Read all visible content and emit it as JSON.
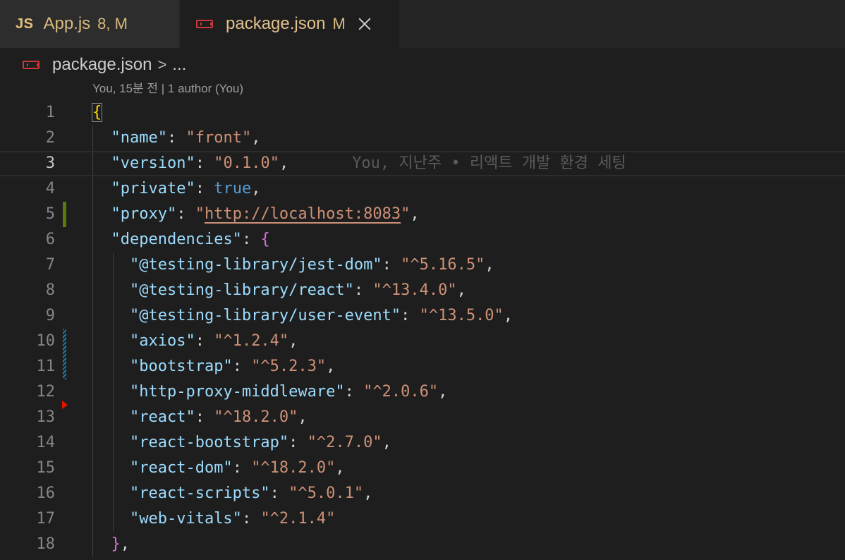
{
  "tabs": [
    {
      "badge": "JS",
      "label": "App.js",
      "status": "8, M"
    },
    {
      "label": "package.json",
      "status": "M"
    }
  ],
  "breadcrumb": {
    "file": "package.json",
    "separator": ">",
    "more": "..."
  },
  "codelens": "You, 15분 전 | 1 author (You)",
  "blame": "You, 지난주 • 리액트 개발 환경 세팅",
  "current_line": 3,
  "lines": [
    {
      "n": "1"
    },
    {
      "n": "2"
    },
    {
      "n": "3"
    },
    {
      "n": "4"
    },
    {
      "n": "5"
    },
    {
      "n": "6"
    },
    {
      "n": "7"
    },
    {
      "n": "8"
    },
    {
      "n": "9"
    },
    {
      "n": "10"
    },
    {
      "n": "11"
    },
    {
      "n": "12"
    },
    {
      "n": "13"
    },
    {
      "n": "14"
    },
    {
      "n": "15"
    },
    {
      "n": "16"
    },
    {
      "n": "17"
    },
    {
      "n": "18"
    }
  ],
  "code": {
    "name_key": "\"name\"",
    "name_val": "\"front\"",
    "version_key": "\"version\"",
    "version_val": "\"0.1.0\"",
    "private_key": "\"private\"",
    "private_val": "true",
    "proxy_key": "\"proxy\"",
    "proxy_val": "http://localhost:8083",
    "deps_key": "\"dependencies\"",
    "deps": [
      {
        "k": "\"@testing-library/jest-dom\"",
        "v": "\"^5.16.5\"",
        "comma": ","
      },
      {
        "k": "\"@testing-library/react\"",
        "v": "\"^13.4.0\"",
        "comma": ","
      },
      {
        "k": "\"@testing-library/user-event\"",
        "v": "\"^13.5.0\"",
        "comma": ","
      },
      {
        "k": "\"axios\"",
        "v": "\"^1.2.4\"",
        "comma": ","
      },
      {
        "k": "\"bootstrap\"",
        "v": "\"^5.2.3\"",
        "comma": ","
      },
      {
        "k": "\"http-proxy-middleware\"",
        "v": "\"^2.0.6\"",
        "comma": ","
      },
      {
        "k": "\"react\"",
        "v": "\"^18.2.0\"",
        "comma": ","
      },
      {
        "k": "\"react-bootstrap\"",
        "v": "\"^2.7.0\"",
        "comma": ","
      },
      {
        "k": "\"react-dom\"",
        "v": "\"^18.2.0\"",
        "comma": ","
      },
      {
        "k": "\"react-scripts\"",
        "v": "\"^5.0.1\"",
        "comma": ","
      },
      {
        "k": "\"web-vitals\"",
        "v": "\"^2.1.4\"",
        "comma": ""
      }
    ]
  },
  "colors": {
    "modified_gutter": "#587c0c",
    "added_gutter": "#1b81a8",
    "deleted_gutter": "#e51400"
  }
}
